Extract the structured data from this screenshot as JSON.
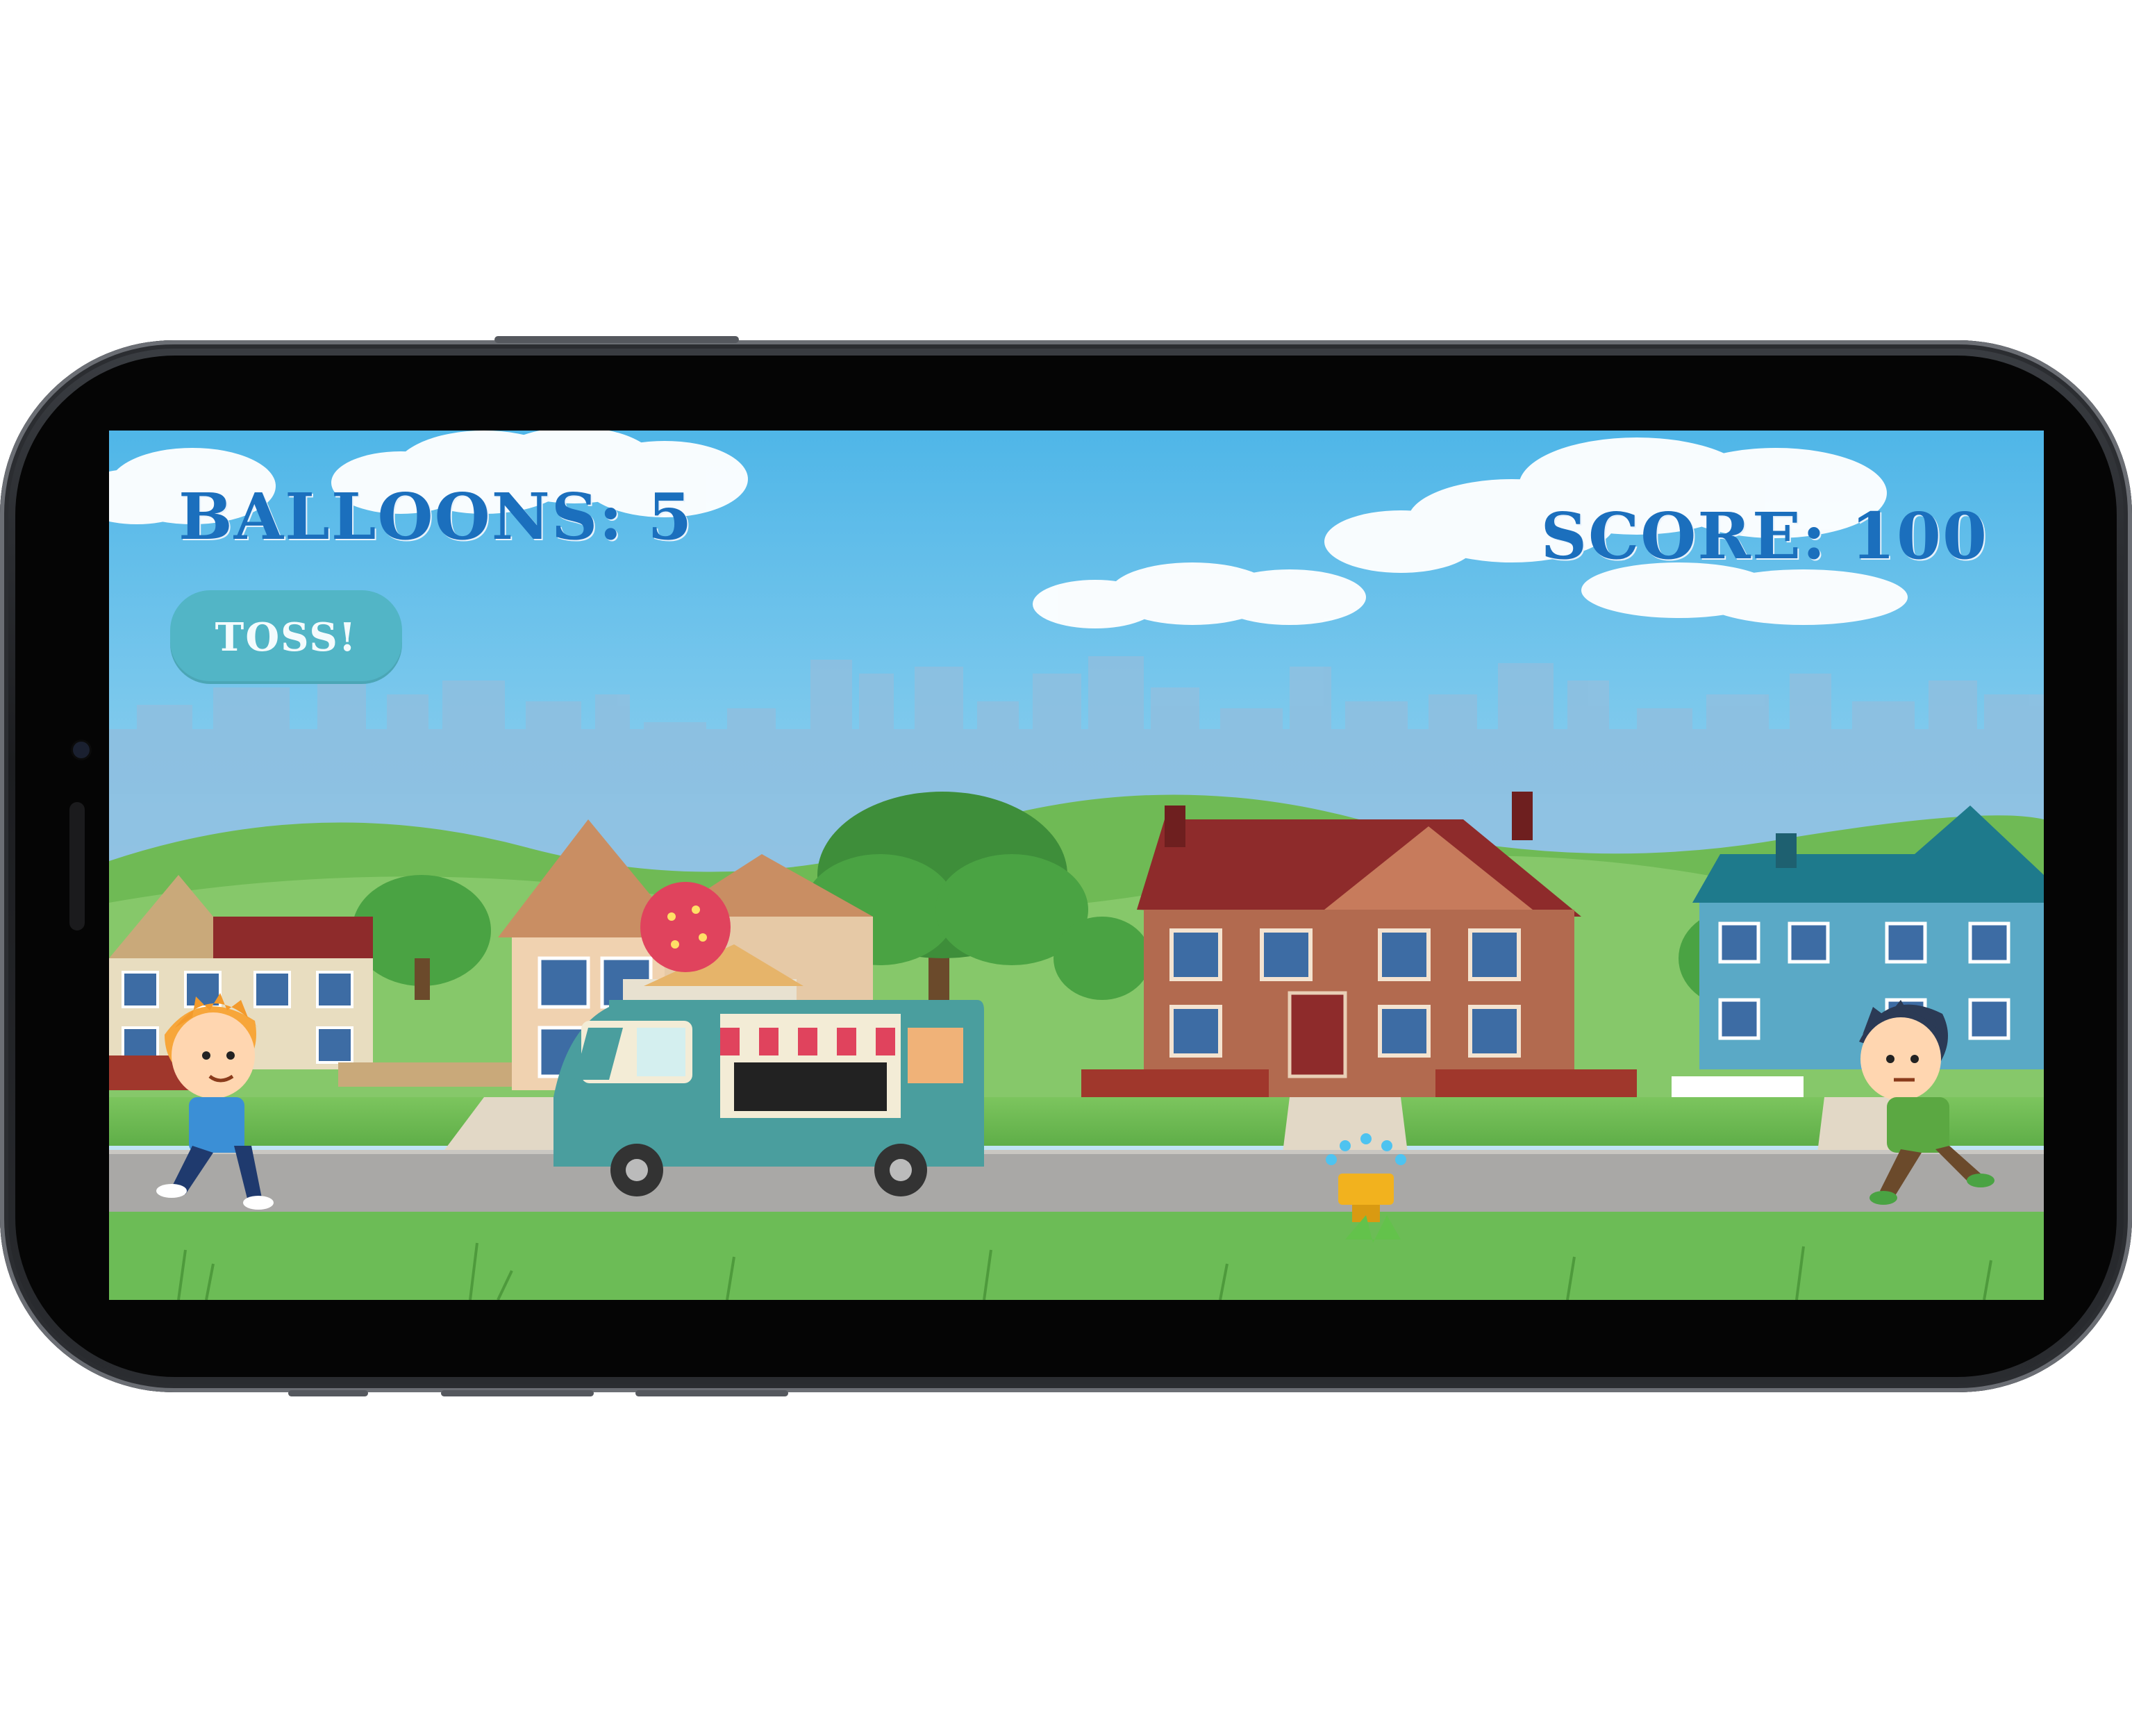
{
  "hud": {
    "balloons_text": "BALLOONS: 5",
    "score_text": "SCORE: 100"
  },
  "controls": {
    "toss_label": "TOSS!"
  },
  "colors": {
    "hud_text": "#1b6fbd",
    "toss_button": "#52b5c6",
    "sky": "#5cc0ea",
    "road": "#a9a8a6",
    "grass": "#72c15a"
  },
  "scene": {
    "icons": [
      "player-boy-orange-hair",
      "rival-boy-green-shirt",
      "ice-cream-truck",
      "water-sprinkler",
      "houses",
      "trees",
      "city-skyline",
      "clouds"
    ]
  }
}
